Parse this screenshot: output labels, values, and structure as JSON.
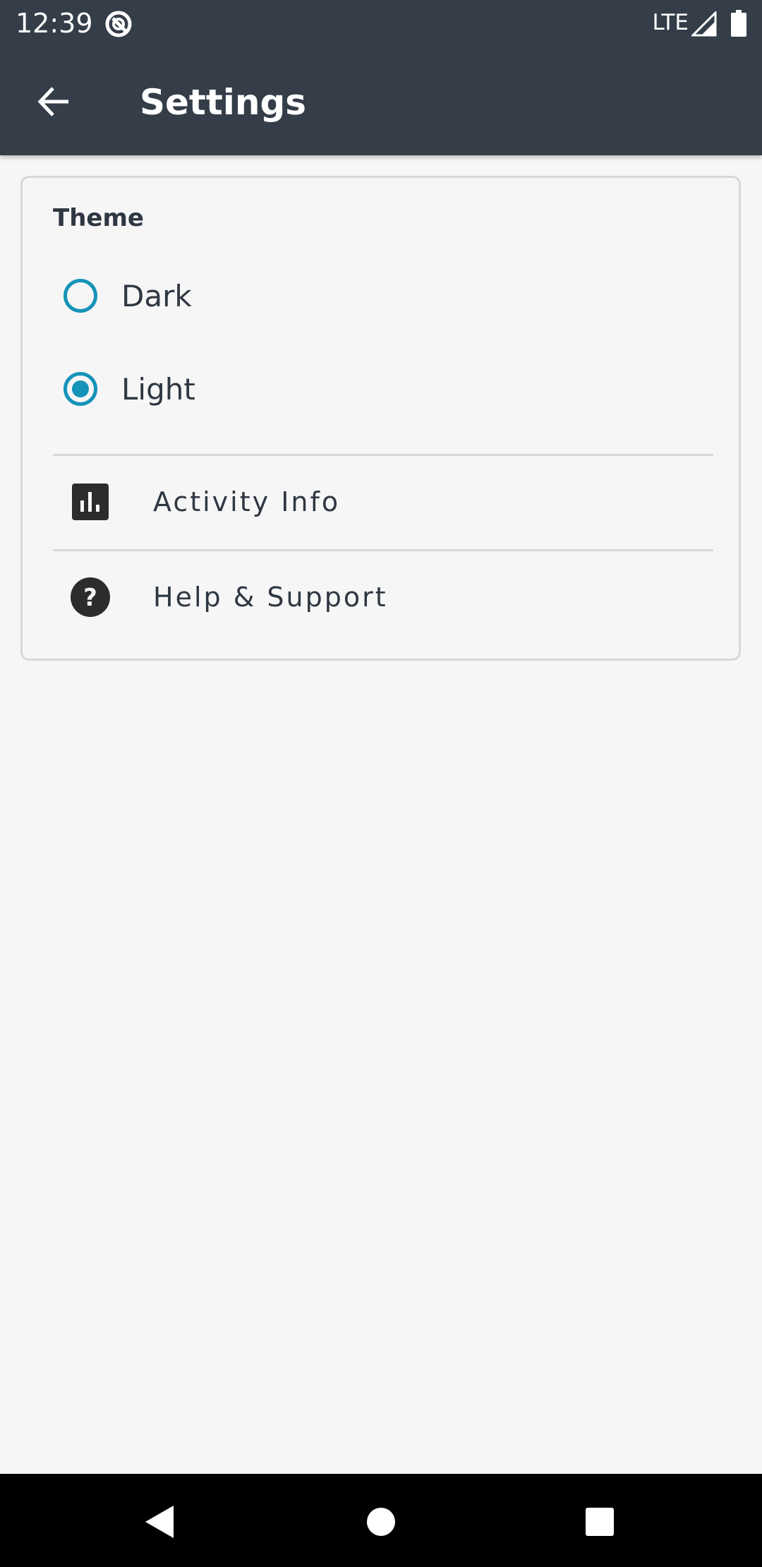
{
  "status_bar": {
    "time": "12:39",
    "network": "LTE",
    "icons": [
      "app-notification-icon",
      "signal-icon",
      "battery-icon"
    ]
  },
  "header": {
    "title": "Settings",
    "back_icon": "arrow-left-icon"
  },
  "theme": {
    "heading": "Theme",
    "options": [
      {
        "label": "Dark",
        "selected": false
      },
      {
        "label": "Light",
        "selected": true
      }
    ]
  },
  "menu": {
    "items": [
      {
        "label": "Activity Info",
        "icon": "bar-chart-icon"
      },
      {
        "label": "Help & Support",
        "icon": "help-circle-icon"
      }
    ]
  },
  "navigation_bar": {
    "icons": [
      "back-triangle-icon",
      "home-circle-icon",
      "recents-square-icon"
    ]
  },
  "colors": {
    "header_bg": "#343d48",
    "accent": "#1593b8",
    "background": "#f6f6f6",
    "text": "#2f3742"
  }
}
